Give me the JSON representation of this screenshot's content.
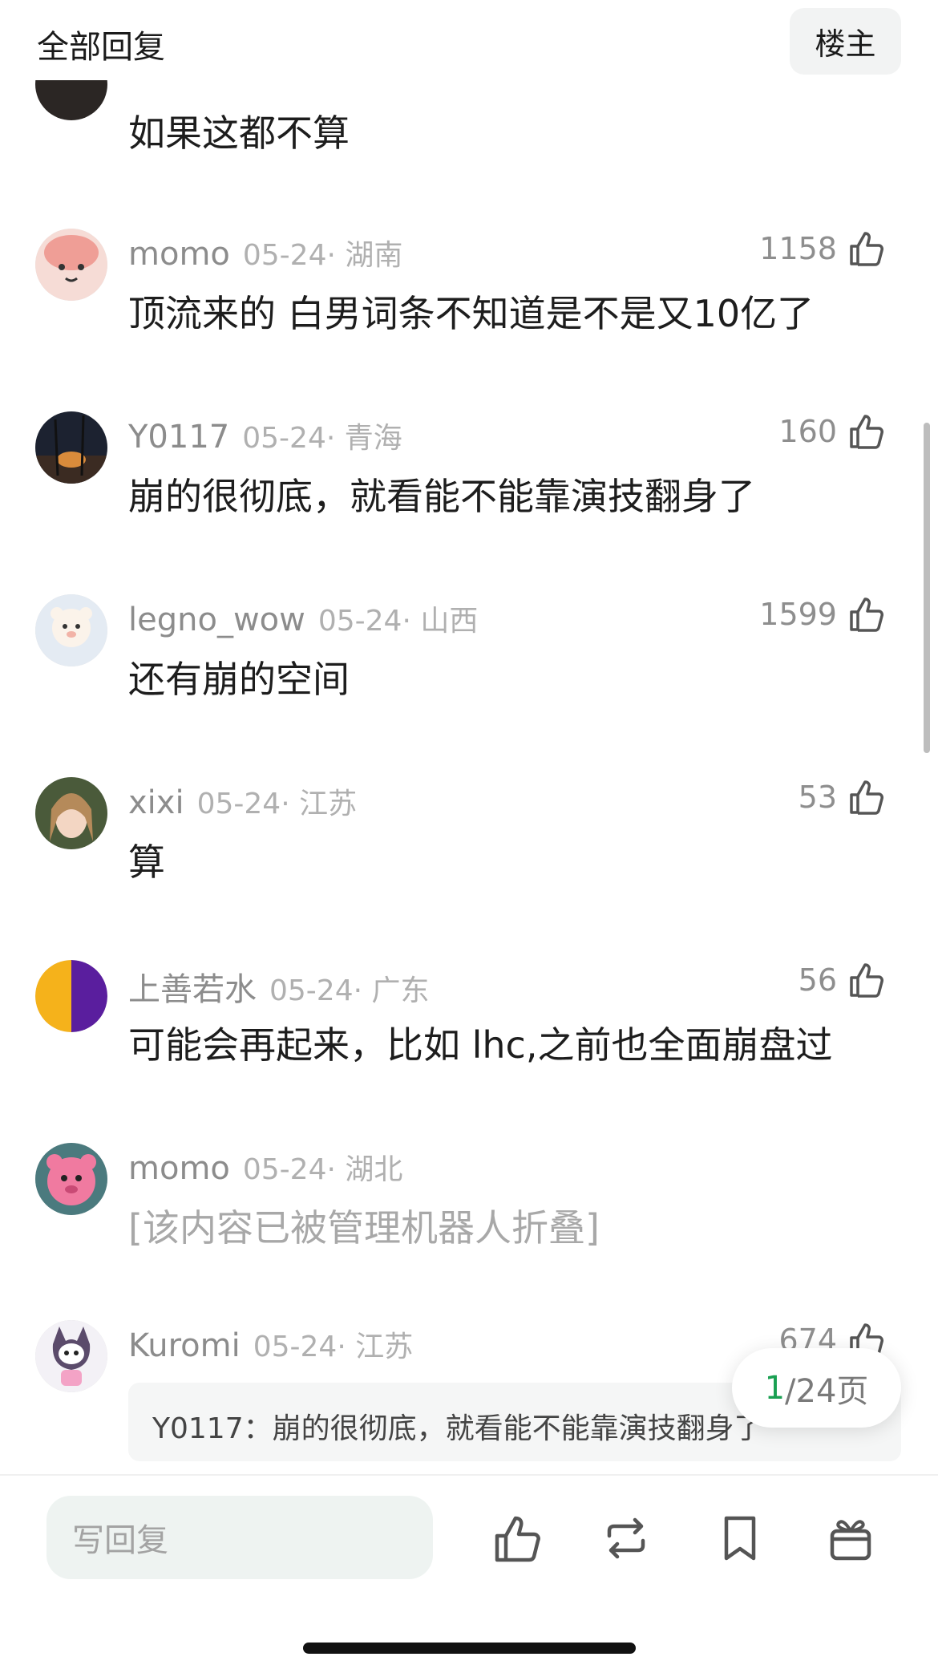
{
  "header": {
    "title": "全部回复",
    "op_button": "楼主"
  },
  "comments": [
    {
      "text": "如果这都不算"
    },
    {
      "user": "momo",
      "date": "05-24",
      "region": "湖南",
      "likes": "1158",
      "text": "顶流来的 白男词条不知道是不是又10亿了"
    },
    {
      "user": "Y0117",
      "date": "05-24",
      "region": "青海",
      "likes": "160",
      "text": "崩的很彻底，就看能不能靠演技翻身了"
    },
    {
      "user": "legno_wow",
      "date": "05-24",
      "region": "山西",
      "likes": "1599",
      "text": "还有崩的空间"
    },
    {
      "user": "xixi",
      "date": "05-24",
      "region": "江苏",
      "likes": "53",
      "text": "算"
    },
    {
      "user": "上善若水",
      "date": "05-24",
      "region": "广东",
      "likes": "56",
      "text": "可能会再起来，比如 lhc,之前也全面崩盘过"
    },
    {
      "user": "momo",
      "date": "05-24",
      "region": "湖北",
      "text": "[该内容已被管理机器人折叠]"
    },
    {
      "user": "Kuromi",
      "date": "05-24",
      "region": "江苏",
      "likes": "674",
      "quote": "Y0117：崩的很彻底，就看能不能靠演技翻身了"
    }
  ],
  "pager": {
    "current": "1",
    "total": "/24页"
  },
  "bottom": {
    "reply_placeholder": "写回复"
  },
  "colors": {
    "accent": "#1aa052",
    "meta": "#9a9a9a",
    "input_bg": "#eef3f1"
  },
  "icons": [
    "thumbs-up-icon",
    "repost-icon",
    "bookmark-icon",
    "gift-icon"
  ]
}
